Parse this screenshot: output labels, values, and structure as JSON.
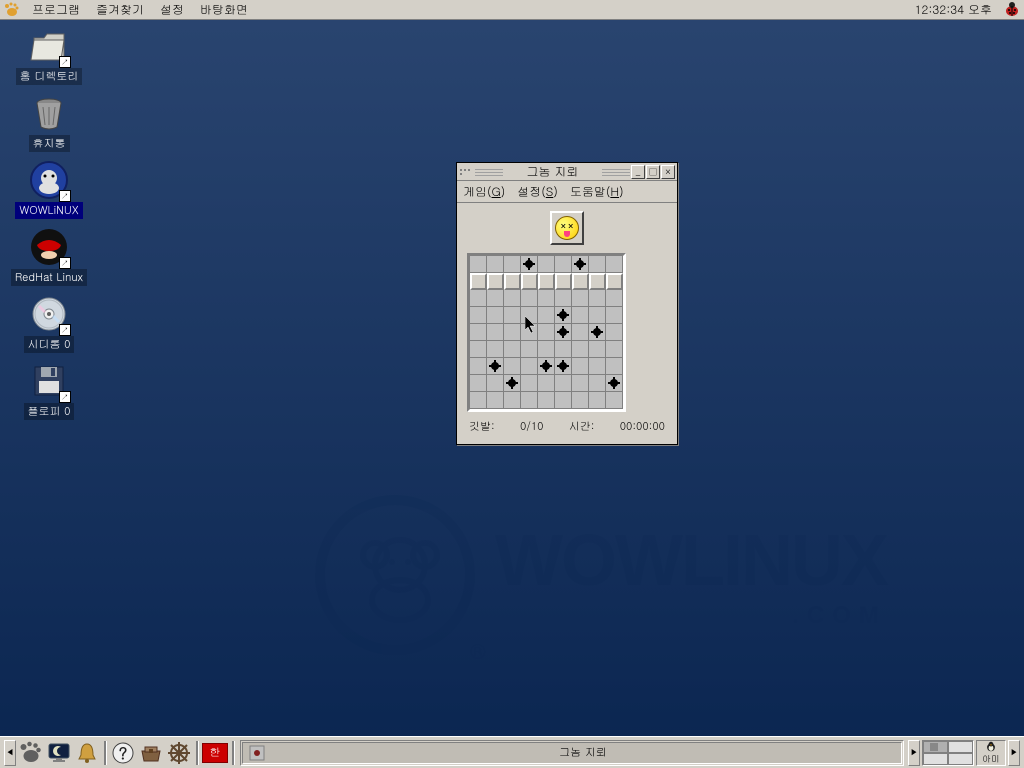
{
  "top_menubar": {
    "items": [
      "프로그램",
      "즐겨찾기",
      "설정",
      "바탕화면"
    ],
    "clock": "12:32:34 오후"
  },
  "desktop_icons": [
    {
      "label": "홈 디렉토리",
      "kind": "folder"
    },
    {
      "label": "휴지통",
      "kind": "trash"
    },
    {
      "label": "WOWLiNUX",
      "kind": "wowlinux",
      "selected": true
    },
    {
      "label": "RedHat Linux",
      "kind": "redhat"
    },
    {
      "label": "시디롬 0",
      "kind": "cdrom"
    },
    {
      "label": "플로피 0",
      "kind": "floppy"
    }
  ],
  "watermark": {
    "big": "WOWLINUX",
    "small": ".COM"
  },
  "minesweeper": {
    "title": "그놈 지뢰",
    "menus": [
      {
        "label": "게임",
        "key": "G"
      },
      {
        "label": "설정",
        "key": "S"
      },
      {
        "label": "도움말",
        "key": "H"
      }
    ],
    "status": {
      "flags_label": "깃발:",
      "flags_value": "0/10",
      "time_label": "시간:",
      "time_value": "00:00:00"
    },
    "face_state": "dead",
    "grid_size": 9,
    "mines": [
      {
        "r": 0,
        "c": 3
      },
      {
        "r": 0,
        "c": 6
      },
      {
        "r": 3,
        "c": 5
      },
      {
        "r": 4,
        "c": 5
      },
      {
        "r": 4,
        "c": 7
      },
      {
        "r": 6,
        "c": 1
      },
      {
        "r": 6,
        "c": 4
      },
      {
        "r": 6,
        "c": 5
      },
      {
        "r": 7,
        "c": 2
      },
      {
        "r": 7,
        "c": 8
      }
    ],
    "covered_rows": [
      1
    ]
  },
  "taskbar": {
    "han_label": "한",
    "task_button_label": "그놈 지뢰",
    "ami_label": "아미"
  }
}
